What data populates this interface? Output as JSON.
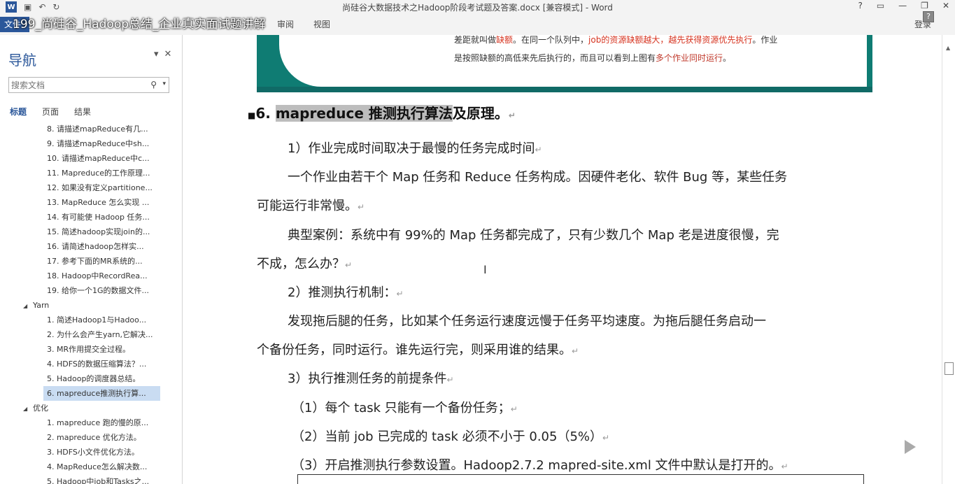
{
  "window": {
    "doc_title": "尚硅谷大数据技术之Hadoop阶段考试题及答案.docx [兼容模式] - Word",
    "overlay_title": "199_尚硅谷_Hadoop总结_企业真实面试题讲解",
    "help": "?",
    "login": "登录"
  },
  "ribbon": {
    "file": "文件",
    "tabs": [
      "审阅",
      "视图"
    ]
  },
  "nav": {
    "title": "导航",
    "search_placeholder": "搜索文档",
    "tabs": [
      "标题",
      "页面",
      "结果"
    ],
    "items": [
      {
        "label": "8. 请描述mapReduce有几...",
        "level": 2
      },
      {
        "label": "9. 请描述mapReduce中sh...",
        "level": 2
      },
      {
        "label": "10. 请描述mapReduce中c...",
        "level": 2
      },
      {
        "label": "11. Mapreduce的工作原理...",
        "level": 2
      },
      {
        "label": "12. 如果没有定义partitione...",
        "level": 2
      },
      {
        "label": "13. MapReduce 怎么实现 ...",
        "level": 2
      },
      {
        "label": "14. 有可能使 Hadoop 任务...",
        "level": 2
      },
      {
        "label": "15. 简述hadoop实现join的...",
        "level": 2
      },
      {
        "label": "16. 请简述hadoop怎样实...",
        "level": 2
      },
      {
        "label": "17.  参考下面的MR系统的...",
        "level": 2
      },
      {
        "label": "18. Hadoop中RecordRea...",
        "level": 2
      },
      {
        "label": "19. 给你一个1G的数据文件...",
        "level": 2
      },
      {
        "label": "Yarn",
        "level": 1
      },
      {
        "label": "1. 简述Hadoop1与Hadoo...",
        "level": 2
      },
      {
        "label": "2. 为什么会产生yarn,它解决...",
        "level": 2
      },
      {
        "label": "3. MR作用提交全过程。",
        "level": 2
      },
      {
        "label": "4. HDFS的数据压缩算法？...",
        "level": 2
      },
      {
        "label": "5. Hadoop的调度器总结。",
        "level": 2
      },
      {
        "label": "6. mapreduce推测执行算...",
        "level": 2,
        "selected": true
      },
      {
        "label": "优化",
        "level": 1
      },
      {
        "label": "1. mapreduce 跑的慢的原...",
        "level": 2
      },
      {
        "label": "2. mapreduce 优化方法。",
        "level": 2
      },
      {
        "label": "3. HDFS小文件优化方法。",
        "level": 2
      },
      {
        "label": "4. MapReduce怎么解决数...",
        "level": 2
      },
      {
        "label": "5. Hadoop中job和Tasks之...",
        "level": 2
      }
    ]
  },
  "document": {
    "img_line1_pre": "差距就叫做",
    "img_line1_red1": "缺额",
    "img_line1_mid": "。在同一个队列中，",
    "img_line1_red2": "job的资源缺额越大，越先获得资源优先执行",
    "img_line1_post": "。作业",
    "img_line2_pre": "是按照缺额的高低来先后执行的，而且可以看到上图有",
    "img_line2_red": "多个作业同时运行",
    "img_line2_post": "。",
    "heading_num": "6. ",
    "heading_hl": "mapreduce",
    "heading_hl2": " 推测执行算法",
    "heading_rest": "及原理。",
    "paragraphs": [
      "1）作业完成时间取决于最慢的任务完成时间",
      "一个作业由若干个 Map 任务和 Reduce 任务构成。因硬件老化、软件 Bug 等，某些任务",
      "可能运行非常慢。",
      "典型案例：系统中有 99%的 Map 任务都完成了，只有少数几个 Map 老是进度很慢，完",
      "不成，怎么办？",
      "2）推测执行机制：",
      "发现拖后腿的任务，比如某个任务运行速度远慢于任务平均速度。为拖后腿任务启动一",
      "个备份任务，同时运行。谁先运行完，则采用谁的结果。",
      "3）执行推测任务的前提条件",
      "（1）每个 task 只能有一个备份任务；",
      "（2）当前 job 已完成的 task 必须不小于 0.05（5%）",
      "（3）开启推测执行参数设置。Hadoop2.7.2 mapred-site.xml 文件中默认是打开的。"
    ]
  }
}
